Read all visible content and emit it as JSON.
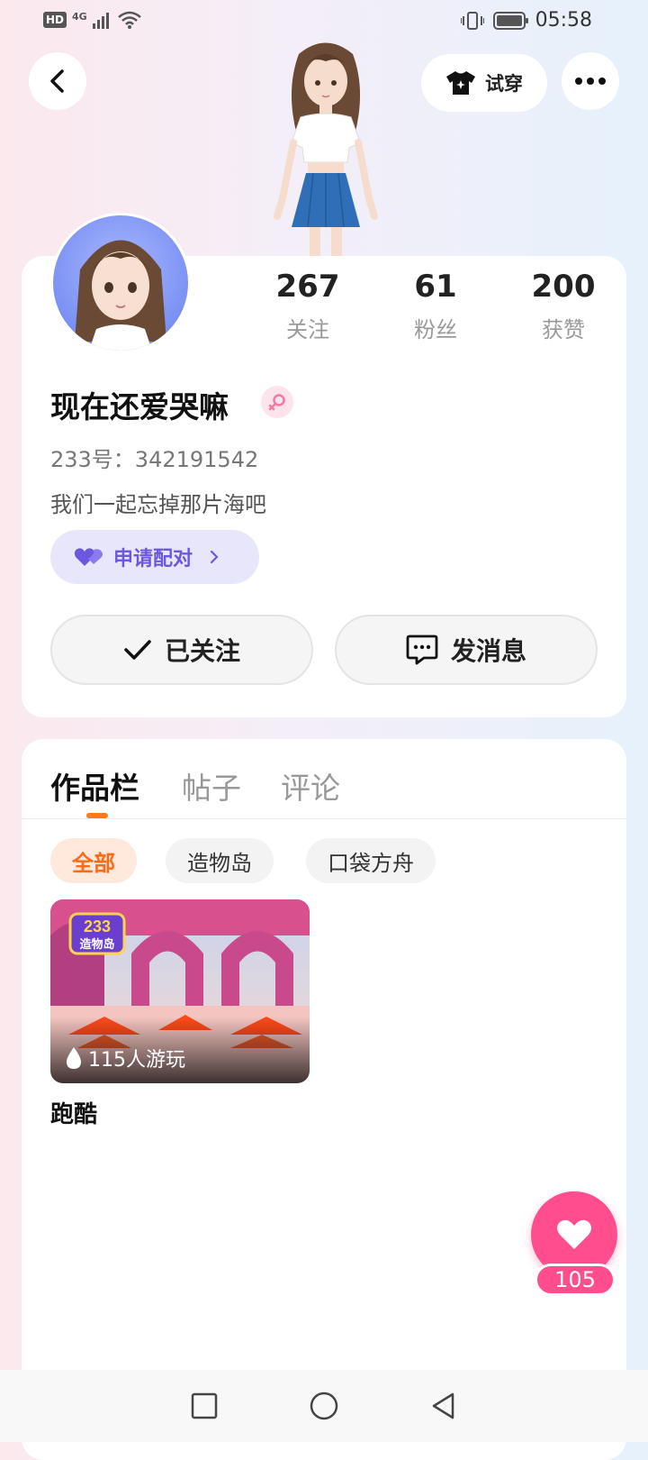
{
  "status_bar": {
    "hd": "HD",
    "network": "4G",
    "time": "05:58"
  },
  "header": {
    "back_icon": "chevron-left-icon",
    "tryon_label": "试穿",
    "more_icon": "more-dots-icon"
  },
  "profile": {
    "stats": [
      {
        "value": "267",
        "label": "关注"
      },
      {
        "value": "61",
        "label": "粉丝"
      },
      {
        "value": "200",
        "label": "获赞"
      }
    ],
    "nickname": "现在还爱哭嘛",
    "gender_icon": "female-icon",
    "id_line": "233号：342191542",
    "bio": "我们一起忘掉那片海吧",
    "pair_label": "申请配对",
    "follow_label": "已关注",
    "message_label": "发消息"
  },
  "tabs": [
    {
      "label": "作品栏",
      "active": true
    },
    {
      "label": "帖子",
      "active": false
    },
    {
      "label": "评论",
      "active": false
    }
  ],
  "filters": [
    {
      "label": "全部",
      "active": true
    },
    {
      "label": "造物岛",
      "active": false
    },
    {
      "label": "口袋方舟",
      "active": false
    }
  ],
  "works": [
    {
      "title": "跑酷",
      "plays": "115人游玩",
      "thumb_logo_top": "233",
      "thumb_logo_bottom": "造物岛"
    }
  ],
  "like_fab": {
    "count": "105"
  },
  "colors": {
    "accent": "#ff7a1a",
    "pink": "#ff4d8d",
    "purple": "#6b57e0"
  }
}
